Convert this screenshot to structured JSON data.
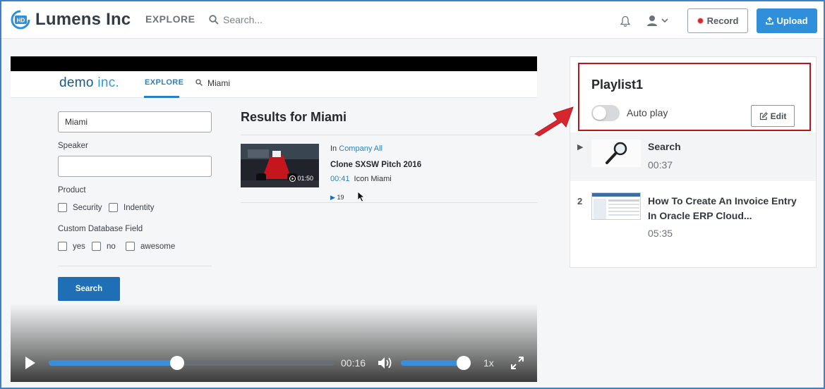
{
  "header": {
    "logo_badge": "HD",
    "brand": "Lumens Inc",
    "nav_explore": "EXPLORE",
    "search_placeholder": "Search...",
    "record_label": "Record",
    "upload_label": "Upload"
  },
  "video": {
    "screen": {
      "logo_main": "demo",
      "logo_suffix": "inc.",
      "nav_explore": "EXPLORE",
      "search_term": "Miami",
      "filters": {
        "keyword_value": "Miami",
        "speaker_label": "Speaker",
        "speaker_value": "",
        "product_label": "Product",
        "product_options": [
          "Security",
          "Indentity"
        ],
        "custom_field_label": "Custom Database Field",
        "custom_options": [
          "yes",
          "no",
          "awesome"
        ],
        "search_button": "Search"
      },
      "results": {
        "title": "Results for Miami",
        "item": {
          "in_prefix": "In",
          "category": "Company All",
          "name": "Clone SXSW Pitch 2016",
          "duration": "01:50",
          "match_time": "00:41",
          "match_text": "Icon Miami",
          "views": "19"
        }
      }
    },
    "controls": {
      "progress_fraction": 0.45,
      "current_time": "00:16",
      "volume_fraction": 0.89,
      "speed": "1x"
    }
  },
  "playlist": {
    "title": "Playlist1",
    "autoplay_label": "Auto play",
    "autoplay_on": false,
    "edit_label": "Edit",
    "items": [
      {
        "index": "▶",
        "name": "Search",
        "duration": "00:37",
        "playing": true
      },
      {
        "index": "2",
        "name": "How To Create An Invoice Entry In Oracle ERP Cloud...",
        "duration": "05:35",
        "playing": false
      }
    ]
  },
  "colors": {
    "accent_blue": "#2f8fdb",
    "record_red": "#e0242c",
    "highlight_red": "#c0121e",
    "progress_blue": "#3a8fd8"
  }
}
